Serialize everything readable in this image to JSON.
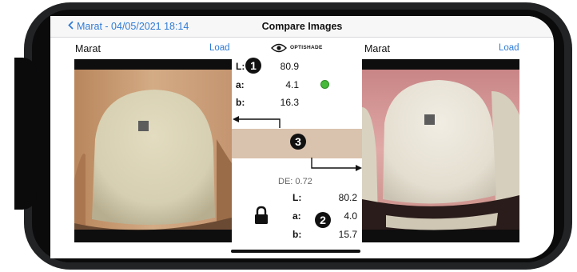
{
  "nav": {
    "back_label": "Marat - 04/05/2021 18:14",
    "title": "Compare Images"
  },
  "left_panel": {
    "patient": "Marat",
    "load_label": "Load",
    "L_label": "L:",
    "L": "80.9",
    "a_label": "a:",
    "a": "4.1",
    "b_label": "b:",
    "b": "16.3"
  },
  "center": {
    "logo": "OPTISHADE",
    "de": "DE: 0.72",
    "match_dot_color": "#46b83a",
    "shade_color": "#d9c2ae",
    "icons": [
      "eye-icon",
      "lock-icon",
      "arrow-left-icon",
      "arrow-right-icon"
    ]
  },
  "right_panel": {
    "patient": "Marat",
    "load_label": "Load",
    "L_label": "L:",
    "L": "80.2",
    "a_label": "a:",
    "a": "4.0",
    "b_label": "b:",
    "b": "15.7"
  },
  "callouts": [
    "1",
    "2",
    "3"
  ],
  "colors": {
    "accent": "#2f7bd6",
    "device_frame": "#222325"
  }
}
